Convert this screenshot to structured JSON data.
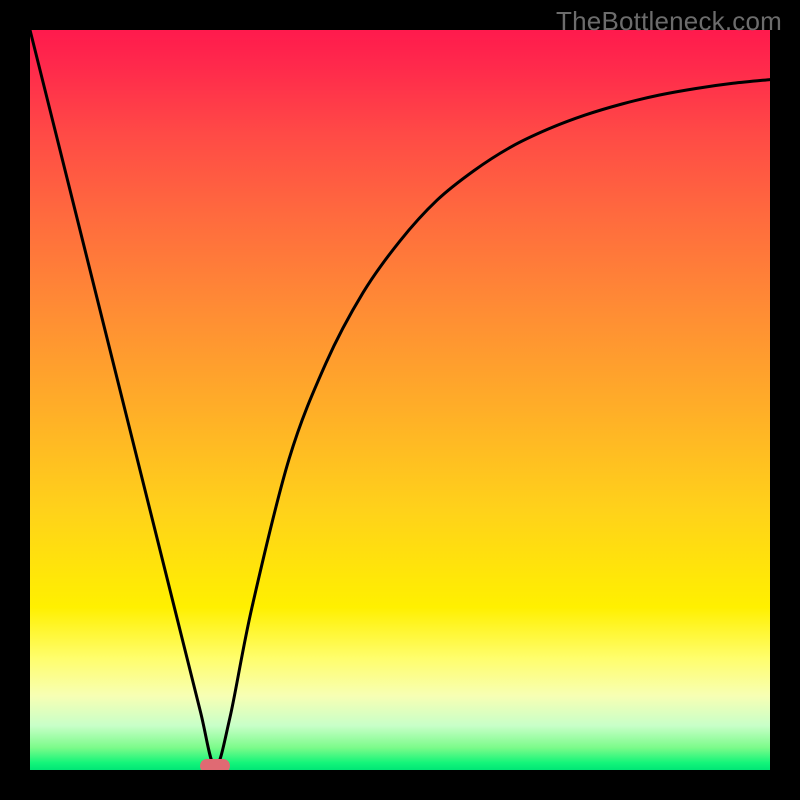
{
  "watermark": "TheBottleneck.com",
  "colors": {
    "page_background": "#000000",
    "gradient_top": "#ff1a4d",
    "gradient_bottom": "#00e676",
    "curve_stroke": "#000000",
    "marker_fill": "#e06a73",
    "watermark_text": "#6c6c6c"
  },
  "chart_data": {
    "type": "line",
    "title": "",
    "xlabel": "",
    "ylabel": "",
    "xlim": [
      0,
      100
    ],
    "ylim": [
      0,
      100
    ],
    "annotations": [
      {
        "name": "minimum-marker",
        "x": 25,
        "y": 0.5
      }
    ],
    "series": [
      {
        "name": "bottleneck-curve",
        "x": [
          0,
          5,
          10,
          15,
          20,
          23,
          25,
          27,
          30,
          35,
          40,
          45,
          50,
          55,
          60,
          65,
          70,
          75,
          80,
          85,
          90,
          95,
          100
        ],
        "values": [
          100,
          80,
          60,
          40,
          20,
          8,
          0.5,
          7,
          22,
          42,
          55,
          64.5,
          71.5,
          77,
          81,
          84.2,
          86.6,
          88.5,
          90,
          91.2,
          92.1,
          92.8,
          93.3
        ]
      }
    ]
  }
}
